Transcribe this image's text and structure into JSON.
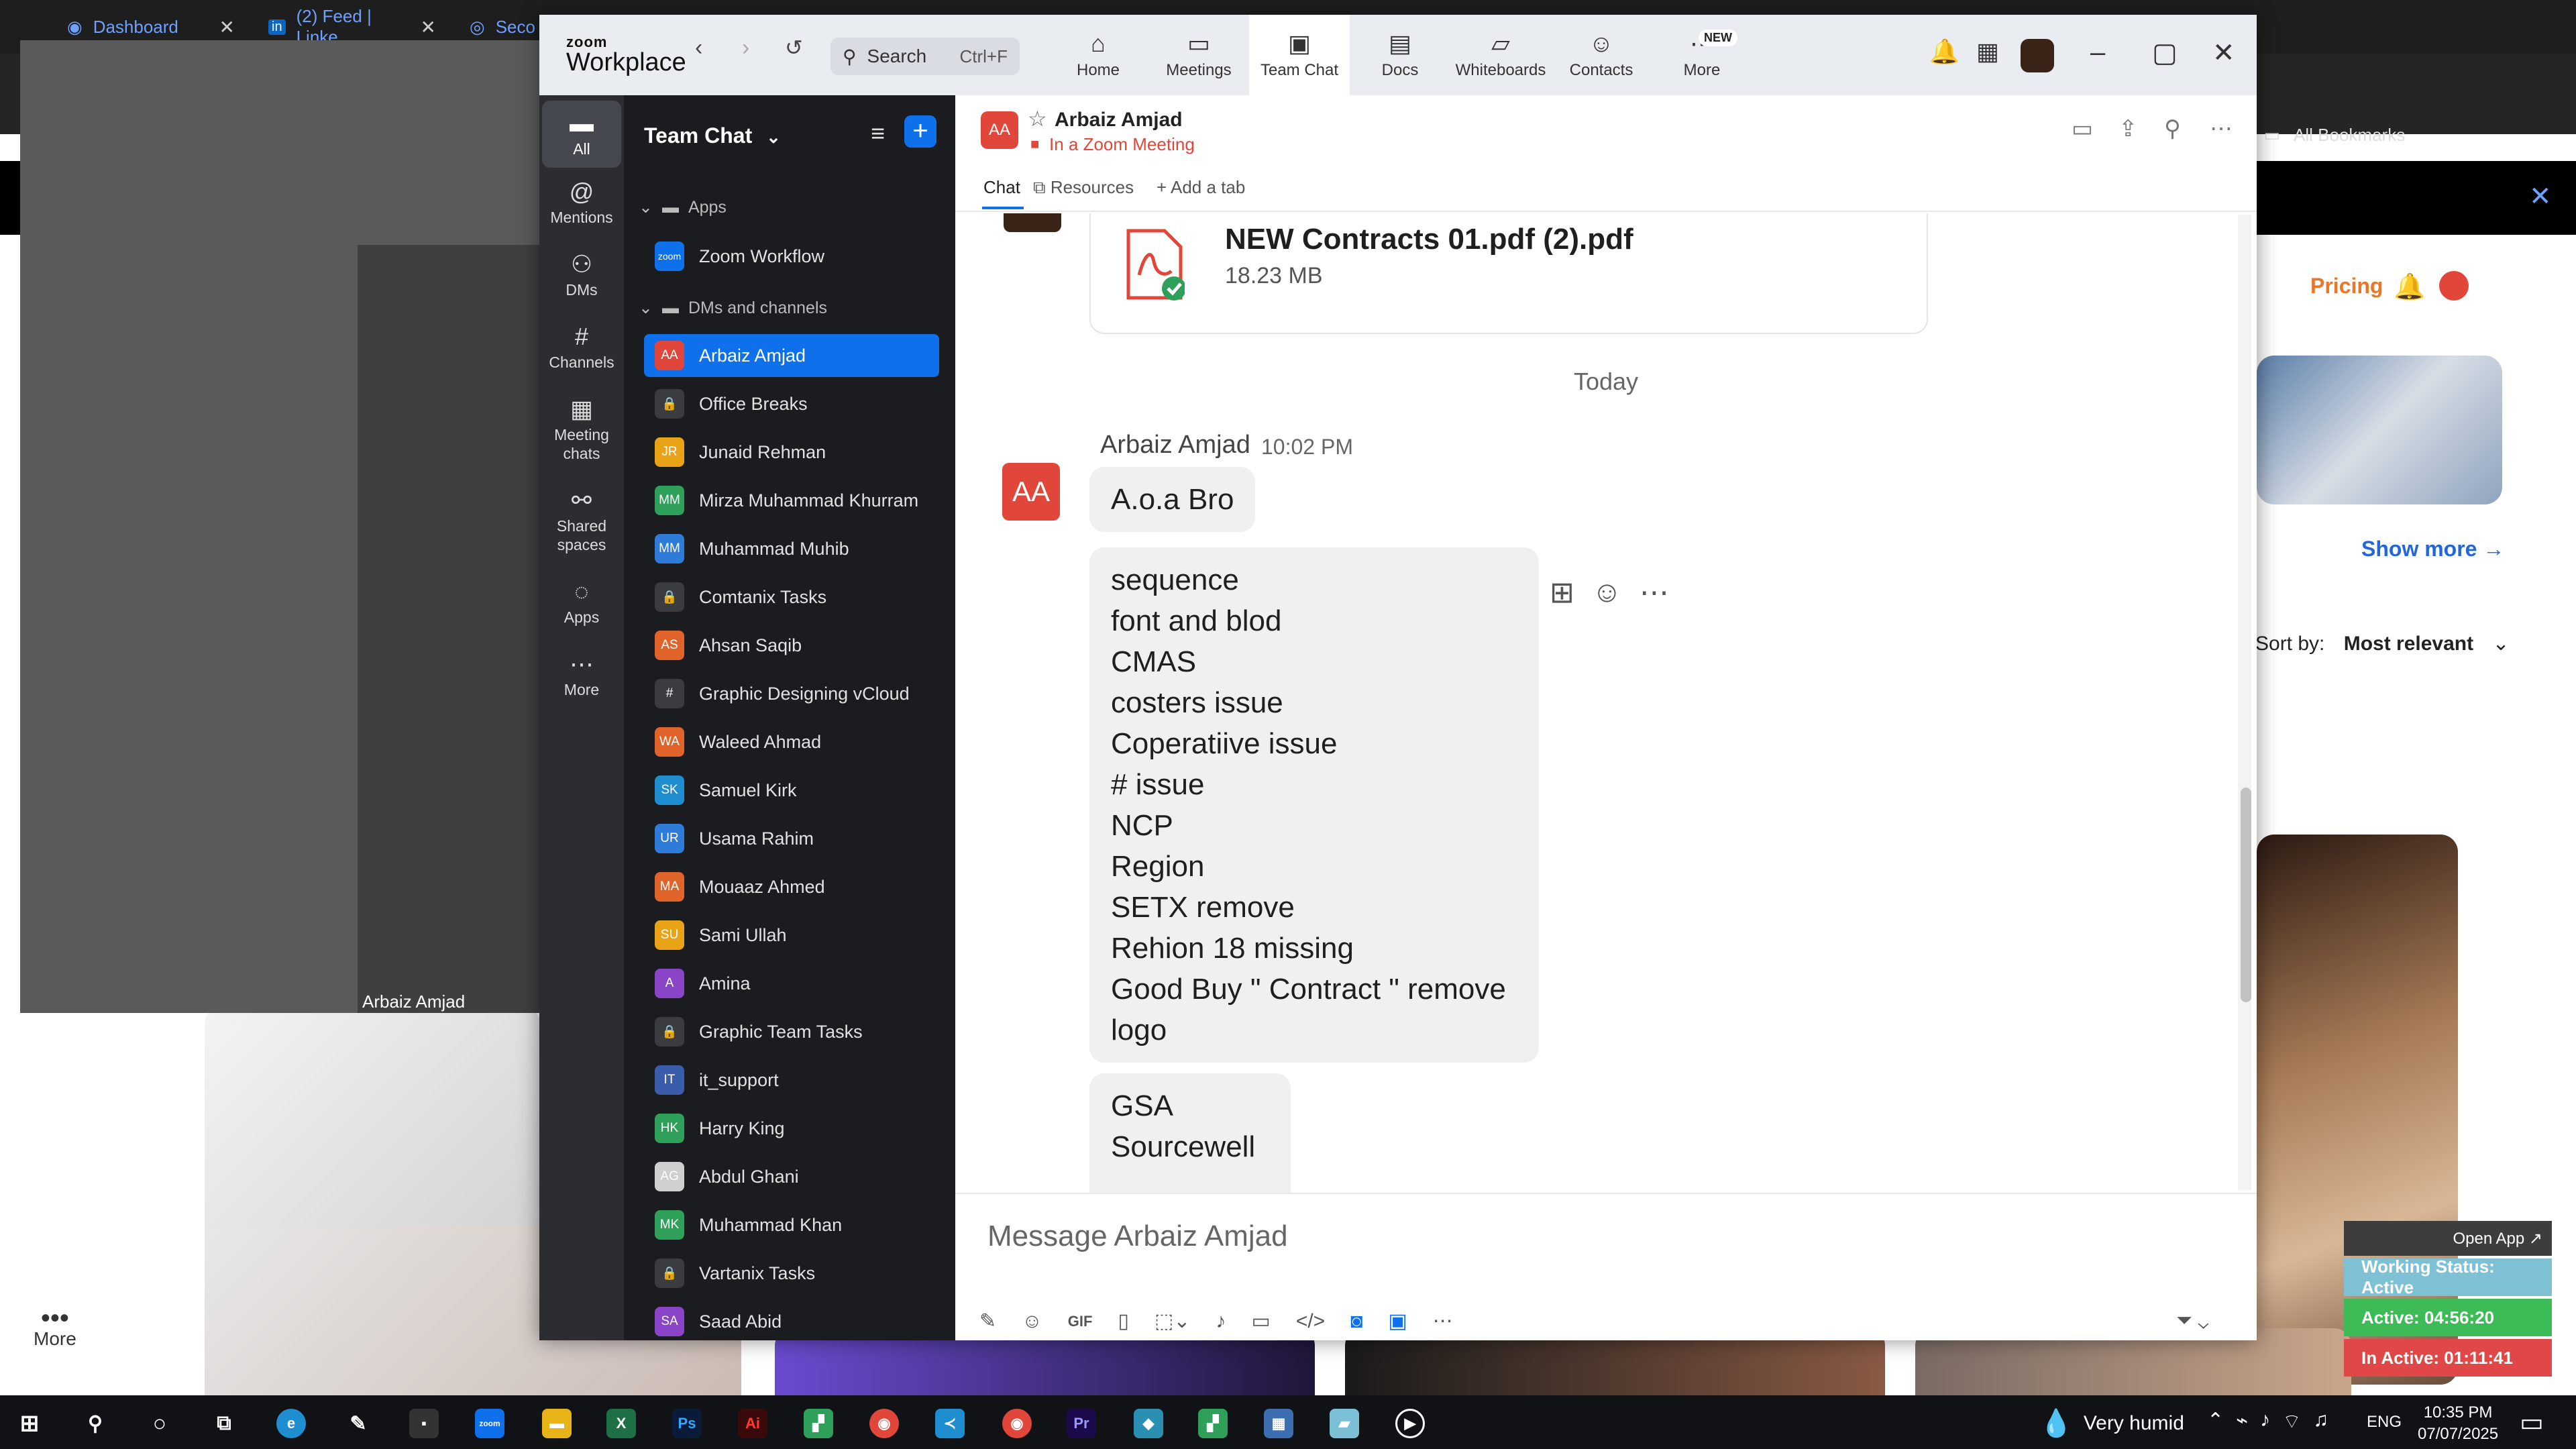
{
  "browser": {
    "tabs": [
      {
        "label": "Dashboard",
        "color": "#6ea0ff"
      },
      {
        "label": "(2) Feed | Linke",
        "color": "#6ea0ff"
      },
      {
        "label": "Seco",
        "color": "#6ea0ff"
      }
    ],
    "bookmarks_label": "All Bookmarks",
    "video_participant": "Arbaiz Amjad"
  },
  "web_page": {
    "pricing": "Pricing",
    "show_more": "Show more →",
    "sort_by_label": "Sort by:",
    "sort_by_value": "Most relevant",
    "more_label": "More"
  },
  "tray_widget": {
    "open_app": "Open App ↗",
    "working_status": "Working Status: Active",
    "active": "Active: 04:56:20",
    "inactive": "In Active: 01:11:41"
  },
  "zoom": {
    "logo_small": "zoom",
    "logo_big": "Workplace",
    "search_placeholder": "Search",
    "search_shortcut": "Ctrl+F",
    "top_tabs": [
      {
        "label": "Home",
        "icon": "home-icon"
      },
      {
        "label": "Meetings",
        "icon": "video-icon"
      },
      {
        "label": "Team Chat",
        "icon": "chat-icon",
        "active": true
      },
      {
        "label": "Docs",
        "icon": "docs-icon"
      },
      {
        "label": "Whiteboards",
        "icon": "whiteboard-icon"
      },
      {
        "label": "Contacts",
        "icon": "contacts-icon"
      },
      {
        "label": "More",
        "icon": "more-icon",
        "badge": "NEW"
      }
    ],
    "rail": [
      {
        "label": "All",
        "icon": "chat-bubble-icon",
        "active": true
      },
      {
        "label": "Mentions",
        "icon": "at-icon"
      },
      {
        "label": "DMs",
        "icon": "people-icon"
      },
      {
        "label": "Channels",
        "icon": "hash-icon"
      },
      {
        "label": "Meeting chats",
        "icon": "calendar-icon"
      },
      {
        "label": "Shared spaces",
        "icon": "shared-icon"
      },
      {
        "label": "Apps",
        "icon": "apps-icon"
      },
      {
        "label": "More",
        "icon": "ellipsis-icon"
      }
    ],
    "sidebar": {
      "title": "Team Chat",
      "apps_section": "Apps",
      "dms_section": "DMs and channels",
      "app_items": [
        {
          "label": "Zoom Workflow",
          "avatar": "zoom",
          "color": "#0e71eb"
        }
      ],
      "items": [
        {
          "label": "Arbaiz Amjad",
          "avatar": "AA",
          "color": "#e0463a",
          "active": true
        },
        {
          "label": "Office Breaks",
          "avatar": "🔒",
          "color": "#3a3c40"
        },
        {
          "label": "Junaid Rehman",
          "avatar": "JR",
          "color": "#e8a317"
        },
        {
          "label": "Mirza Muhammad Khurram",
          "avatar": "MM",
          "color": "#2ea05a"
        },
        {
          "label": "Muhammad Muhib",
          "avatar": "MM",
          "color": "#2f7bd8"
        },
        {
          "label": "Comtanix Tasks",
          "avatar": "🔒",
          "color": "#3a3c40"
        },
        {
          "label": "Ahsan Saqib",
          "avatar": "AS",
          "color": "#e0632a"
        },
        {
          "label": "Graphic Designing vCloud",
          "avatar": "#",
          "color": "#3a3c40"
        },
        {
          "label": "Waleed Ahmad",
          "avatar": "WA",
          "color": "#e0632a"
        },
        {
          "label": "Samuel Kirk",
          "avatar": "SK",
          "color": "#1f8ed0"
        },
        {
          "label": "Usama Rahim",
          "avatar": "UR",
          "color": "#2f7bd8"
        },
        {
          "label": "Mouaaz Ahmed",
          "avatar": "MA",
          "color": "#e0632a"
        },
        {
          "label": "Sami Ullah",
          "avatar": "SU",
          "color": "#e8a317"
        },
        {
          "label": "Amina",
          "avatar": "A",
          "color": "#8a44c8"
        },
        {
          "label": "Graphic Team Tasks",
          "avatar": "🔒",
          "color": "#3a3c40"
        },
        {
          "label": "it_support",
          "avatar": "IT",
          "color": "#3a5caa"
        },
        {
          "label": "Harry King",
          "avatar": "HK",
          "color": "#2ea05a"
        },
        {
          "label": "Abdul Ghani",
          "avatar": "AG",
          "color": "#cfcfcf"
        },
        {
          "label": "Muhammad Khan",
          "avatar": "MK",
          "color": "#2ea05a"
        },
        {
          "label": "Vartanix Tasks",
          "avatar": "🔒",
          "color": "#3a3c40"
        },
        {
          "label": "Saad Abid",
          "avatar": "SA",
          "color": "#8a44c8"
        }
      ]
    },
    "chat": {
      "avatar": "AA",
      "name": "Arbaiz Amjad",
      "status": "In a Zoom Meeting",
      "tabs": [
        "Chat",
        "Resources",
        "Add a tab"
      ],
      "file": {
        "name": "NEW Contracts 01.pdf (2).pdf",
        "size": "18.23 MB"
      },
      "date_divider": "Today",
      "author": "Arbaiz Amjad",
      "time": "10:02 PM",
      "messages": [
        "A.o.a Bro",
        "sequence\nfont and blod\nCMAS\ncosters issue\nCoperatiive issue\n# issue\nNCP\nRegion\nSETX remove\nRehion 18 missing\nGood Buy \" Contract \" remove\nlogo",
        "GSA\nSourcewell"
      ],
      "compose_placeholder": "Message Arbaiz Amjad"
    }
  },
  "taskbar": {
    "weather": "Very humid",
    "lang": "ENG",
    "time": "10:35 PM",
    "date": "07/07/2025"
  }
}
